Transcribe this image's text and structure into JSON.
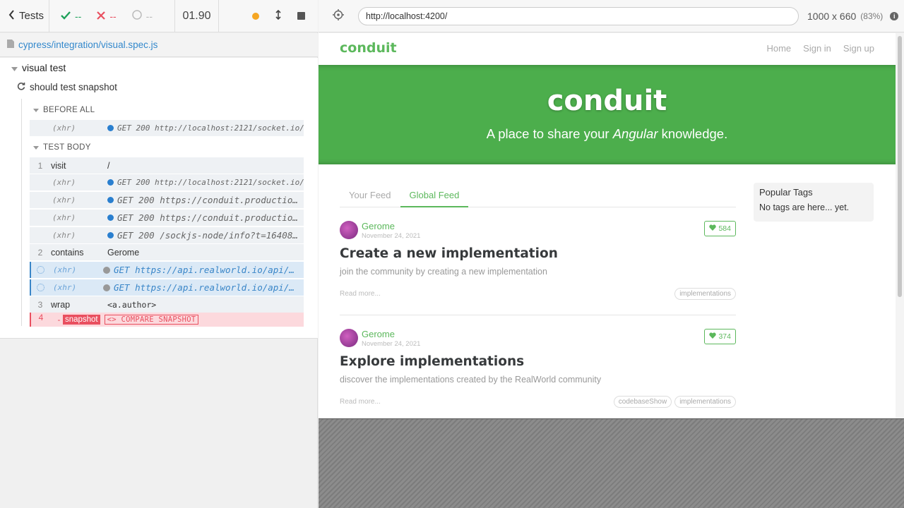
{
  "runner": {
    "back_label": "Tests",
    "passed": "--",
    "failed": "--",
    "pending": "--",
    "duration": "01.90",
    "spec_path": "cypress/integration/visual.spec.js",
    "suite_title": "visual test",
    "test_title": "should test snapshot",
    "before_all_label": "BEFORE ALL",
    "test_body_label": "TEST BODY",
    "before_all_commands": [
      {
        "name": "(xhr)",
        "message": "GET 200 http://localhost:2121/socket.io/…"
      }
    ],
    "commands": [
      {
        "num": "1",
        "name": "visit",
        "message": "/"
      },
      {
        "num": "",
        "name": "(xhr)",
        "message": "GET 200 http://localhost:2121/socket.io/…"
      },
      {
        "num": "",
        "name": "(xhr)",
        "message": "GET 200 https://conduit.productio…"
      },
      {
        "num": "",
        "name": "(xhr)",
        "message": "GET 200 https://conduit.productio…"
      },
      {
        "num": "",
        "name": "(xhr)",
        "message": "GET 200 /sockjs-node/info?t=16408…"
      },
      {
        "num": "2",
        "name": "contains",
        "message": "Gerome"
      },
      {
        "num": "",
        "name": "(xhr)",
        "message": "GET https://api.realworld.io/api/…"
      },
      {
        "num": "",
        "name": "(xhr)",
        "message": "GET https://api.realworld.io/api/…"
      },
      {
        "num": "3",
        "name": "wrap",
        "message": "<a.author>"
      },
      {
        "num": "4",
        "name": "snapshot",
        "prefix": "-",
        "message": "<> COMPARE SNAPSHOT"
      }
    ]
  },
  "browser": {
    "url": "http://localhost:4200/",
    "viewport": "1000 x 660",
    "scale": "(83%)"
  },
  "app": {
    "brand": "conduit",
    "nav": [
      "Home",
      "Sign in",
      "Sign up"
    ],
    "banner_title": "conduit",
    "banner_pre": "A place to share your",
    "banner_em": "Angular",
    "banner_post": "knowledge.",
    "tabs": [
      "Your Feed",
      "Global Feed"
    ],
    "articles": [
      {
        "author": "Gerome",
        "date": "November 24, 2021",
        "favorites": "584",
        "title": "Create a new implementation",
        "description": "join the community by creating a new implementation",
        "read_more": "Read more...",
        "tags": [
          "implementations"
        ]
      },
      {
        "author": "Gerome",
        "date": "November 24, 2021",
        "favorites": "374",
        "title": "Explore implementations",
        "description": "discover the implementations created by the RealWorld community",
        "read_more": "Read more...",
        "tags": [
          "codebaseShow",
          "implementations"
        ]
      }
    ],
    "sidebar_title": "Popular Tags",
    "sidebar_empty": "No tags are here... yet."
  },
  "colors": {
    "brand_green": "#5cb85c",
    "pass": "#1fa15a",
    "fail": "#e94f5f",
    "link_blue": "#3388cc"
  }
}
